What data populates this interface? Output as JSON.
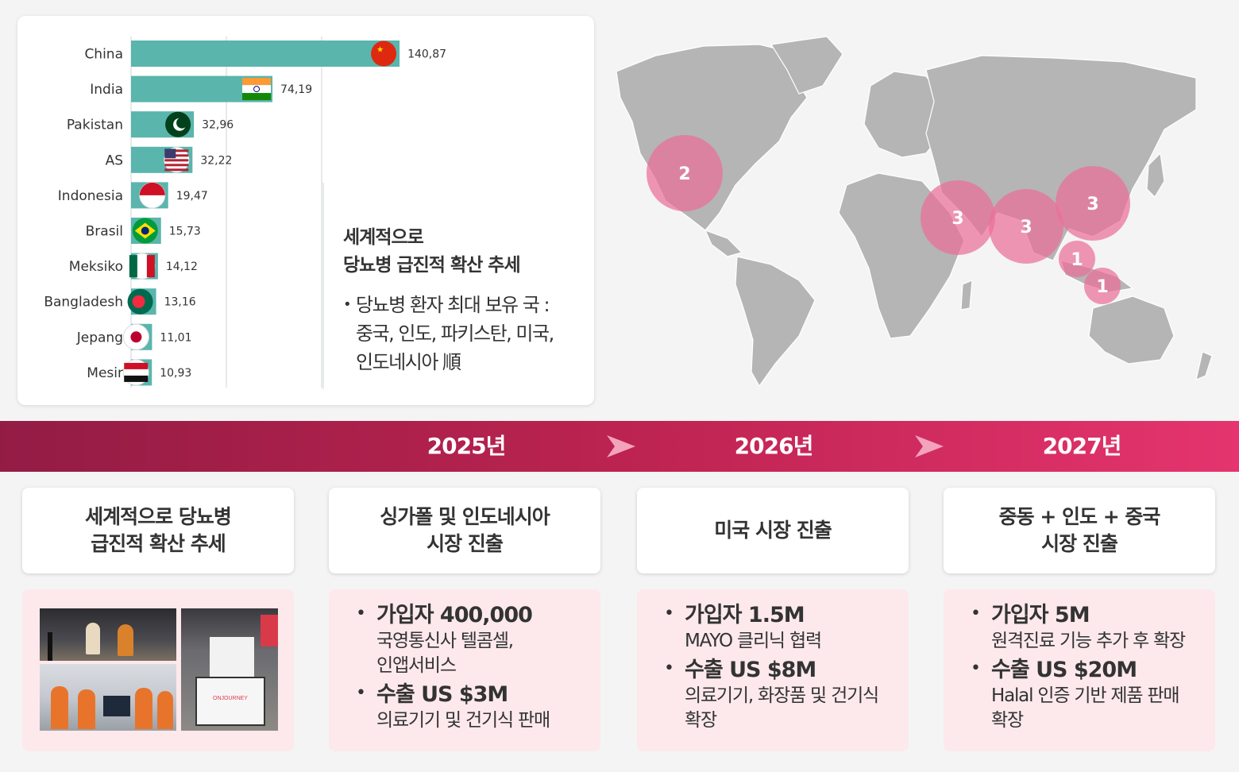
{
  "chart_data": {
    "type": "bar",
    "orientation": "horizontal",
    "categories": [
      "China",
      "India",
      "Pakistan",
      "AS",
      "Indonesia",
      "Brasil",
      "Meksiko",
      "Bangladesh",
      "Jepang",
      "Mesir"
    ],
    "values": [
      140.87,
      74.19,
      32.96,
      32.22,
      19.47,
      15.73,
      14.12,
      13.16,
      11.01,
      10.93
    ],
    "value_labels": [
      "140,87",
      "74,19",
      "32,96",
      "32,22",
      "19,47",
      "15,73",
      "14,12",
      "13,16",
      "11,01",
      "10,93"
    ],
    "xlim": [
      0,
      150
    ],
    "bar_color": "#5ab5ad",
    "grid": true
  },
  "chart_note": {
    "title_line1": "세계적으로",
    "title_line2": "당뇨병 급진적 확산 추세",
    "bullet_line1": "당뇨병 환자 최대 보유 국 :",
    "bullet_line2": "중국, 인도, 파키스탄, 미국,",
    "bullet_line3": "인도네시아 順"
  },
  "map": {
    "land_color": "#b5b5b5",
    "marker_color": "#ec6f9a",
    "markers": [
      {
        "label": "2"
      },
      {
        "label": "3"
      },
      {
        "label": "3"
      },
      {
        "label": "3"
      },
      {
        "label": "1"
      },
      {
        "label": "1"
      }
    ]
  },
  "timeline": {
    "years": [
      "2025년",
      "2026년",
      "2027년"
    ],
    "arrow_color": "#f4a3bd"
  },
  "columns": [
    {
      "head_line1": "세계적으로 당뇨병",
      "head_line2": "급진적 확산 추세",
      "photos": true
    },
    {
      "head_line1": "싱가폴 및 인도네시아",
      "head_line2": "시장 진출",
      "items": [
        {
          "title": "가입자 400,000",
          "sub": [
            "국영통신사 텔콤셀,",
            "인앱서비스"
          ]
        },
        {
          "title": "수출 US $3M",
          "sub": [
            "의료기기 및 건기식 판매"
          ]
        }
      ]
    },
    {
      "head_line1": "미국 시장 진출",
      "head_line2": "",
      "items": [
        {
          "title": "가입자 1.5M",
          "sub": [
            "MAYO 클리닉 협력"
          ]
        },
        {
          "title": "수출 US $8M",
          "sub": [
            "의료기기, 화장품 및 건기식",
            "확장"
          ]
        }
      ]
    },
    {
      "head_line1": "중동 + 인도 + 중국",
      "head_line2": "시장 진출",
      "items": [
        {
          "title": "가입자 5M",
          "sub": [
            "원격진료 기능 추가 후 확장"
          ]
        },
        {
          "title": "수출 US $20M",
          "sub": [
            "Halal 인증 기반 제품 판매",
            "확장"
          ]
        }
      ]
    }
  ],
  "photo_caption": "ONJOURNEY"
}
